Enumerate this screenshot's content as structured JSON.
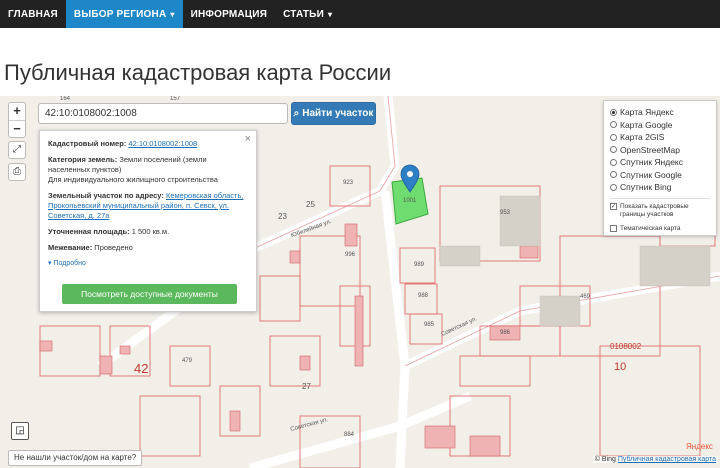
{
  "nav": {
    "items": [
      {
        "label": "ГЛАВНАЯ",
        "active": false,
        "dropdown": false
      },
      {
        "label": "ВЫБОР РЕГИОНА",
        "active": true,
        "dropdown": true
      },
      {
        "label": "ИНФОРМАЦИЯ",
        "active": false,
        "dropdown": false
      },
      {
        "label": "СТАТЬИ",
        "active": false,
        "dropdown": true
      }
    ]
  },
  "page_title": "Публичная кадастровая карта России",
  "search": {
    "value": "42:10:0108002:1008",
    "button_label": "Найти участок"
  },
  "info": {
    "cad_label": "Кадастровый номер:",
    "cad_value": "42:10:0108002:1008",
    "category_label": "Категория земель:",
    "category_value": "Земли поселений (земли населенных пунктов)",
    "use_value": "Для индивидуального жилищного строительства",
    "address_label": "Земельный участок по адресу:",
    "address_value": "Кемеровская область, Прокопьевский муниципальный район, п. Севск, ул. Советская, д. 27а",
    "area_label": "Уточненная площадь:",
    "area_value": "1 500 кв.м.",
    "survey_label": "Межевание:",
    "survey_value": "Проведено",
    "more_label": "Подробно",
    "docs_button": "Посмотреть доступные документы"
  },
  "layers": {
    "base": [
      {
        "label": "Карта Яндекс",
        "selected": true
      },
      {
        "label": "Карта Google",
        "selected": false
      },
      {
        "label": "Карта 2GIS",
        "selected": false
      },
      {
        "label": "OpenStreetMap",
        "selected": false
      },
      {
        "label": "Спутник Яндекс",
        "selected": false
      },
      {
        "label": "Спутник Google",
        "selected": false
      },
      {
        "label": "Спутник Bing",
        "selected": false
      }
    ],
    "overlay_cadastre": "Показать кадастровые границы участков",
    "overlay_thematic": "Тематическая карта"
  },
  "not_found": "Не нашли участок/дом на карте?",
  "attribution": {
    "prefix": "© Bing",
    "link": "Публичная кадастровая карта"
  },
  "watermark": "Яндекс",
  "map_labels": {
    "block_a": "42",
    "block_b": "10",
    "quarter": "0108002",
    "street_1": "Юбилейная ул.",
    "street_2": "Советская ул.",
    "street_3": "Советская ул."
  },
  "plot_numbers": [
    "164",
    "157",
    "923",
    "953",
    "996",
    "989",
    "988",
    "985",
    "986",
    "469",
    "23",
    "25",
    "27",
    "479",
    "884",
    "1001"
  ],
  "colors": {
    "accent": "#1e87c8",
    "button_green": "#5cb85c",
    "button_blue": "#337ab7",
    "boundary": "#e06c6c",
    "selected_plot": "#6fdc6f"
  }
}
